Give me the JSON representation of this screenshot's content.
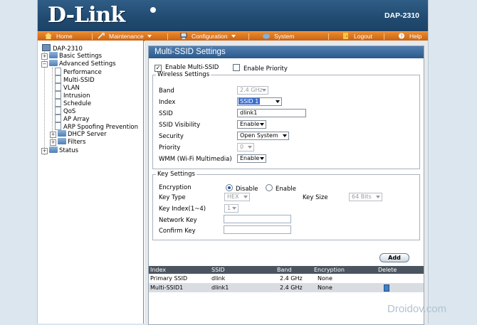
{
  "header": {
    "logo": "D-Link",
    "model": "DAP-2310"
  },
  "menu": [
    {
      "label": "Home",
      "icon": "home-icon"
    },
    {
      "label": "Maintenance",
      "icon": "tools-icon"
    },
    {
      "label": "Configuration",
      "icon": "computer-icon"
    },
    {
      "label": "System",
      "icon": "system-icon"
    },
    {
      "label": "Logout",
      "icon": "logout-icon"
    },
    {
      "label": "Help",
      "icon": "help-icon"
    }
  ],
  "tree": {
    "root": "DAP-2310",
    "basic": "Basic Settings",
    "advanced": "Advanced Settings",
    "children": [
      "Performance",
      "Multi-SSID",
      "VLAN",
      "Intrusion",
      "Schedule",
      "QoS",
      "AP Array",
      "ARP Spoofing Prevention"
    ],
    "dhcp": "DHCP Server",
    "filters": "Filters",
    "status": "Status"
  },
  "panel": {
    "title": "Multi-SSID Settings",
    "enable_multi_ssid": {
      "label": "Enable Multi-SSID",
      "checked": true
    },
    "enable_priority": {
      "label": "Enable Priority",
      "checked": false
    }
  },
  "wireless": {
    "legend": "Wireless Settings",
    "band": {
      "label": "Band",
      "value": "2.4 GHz"
    },
    "index": {
      "label": "Index",
      "value": "SSID 1"
    },
    "ssid": {
      "label": "SSID",
      "value": "dlink1"
    },
    "visibility": {
      "label": "SSID Visibility",
      "value": "Enable"
    },
    "security": {
      "label": "Security",
      "value": "Open System"
    },
    "priority": {
      "label": "Priority",
      "value": "0"
    },
    "wmm": {
      "label": "WMM (Wi-Fi Multimedia)",
      "value": "Enable"
    }
  },
  "key": {
    "legend": "Key Settings",
    "encryption": {
      "label": "Encryption",
      "disable": "Disable",
      "enable": "Enable",
      "selected": "Disable"
    },
    "key_type": {
      "label": "Key Type",
      "value": "HEX"
    },
    "key_size": {
      "label": "Key Size",
      "value": "64 Bits"
    },
    "key_index": {
      "label": "Key Index(1~4)",
      "value": "1"
    },
    "network_key": {
      "label": "Network Key",
      "value": ""
    },
    "confirm_key": {
      "label": "Confirm Key",
      "value": ""
    }
  },
  "add_button": "Add",
  "table": {
    "headers": [
      "Index",
      "SSID",
      "Band",
      "Encryption",
      "Delete"
    ],
    "rows": [
      [
        "Primary SSID",
        "dlink",
        "2.4 GHz",
        "None",
        ""
      ],
      [
        "Multi-SSID1",
        "dlink1",
        "2.4 GHz",
        "None",
        "trash-icon"
      ]
    ]
  },
  "watermark": "Droidov.com"
}
